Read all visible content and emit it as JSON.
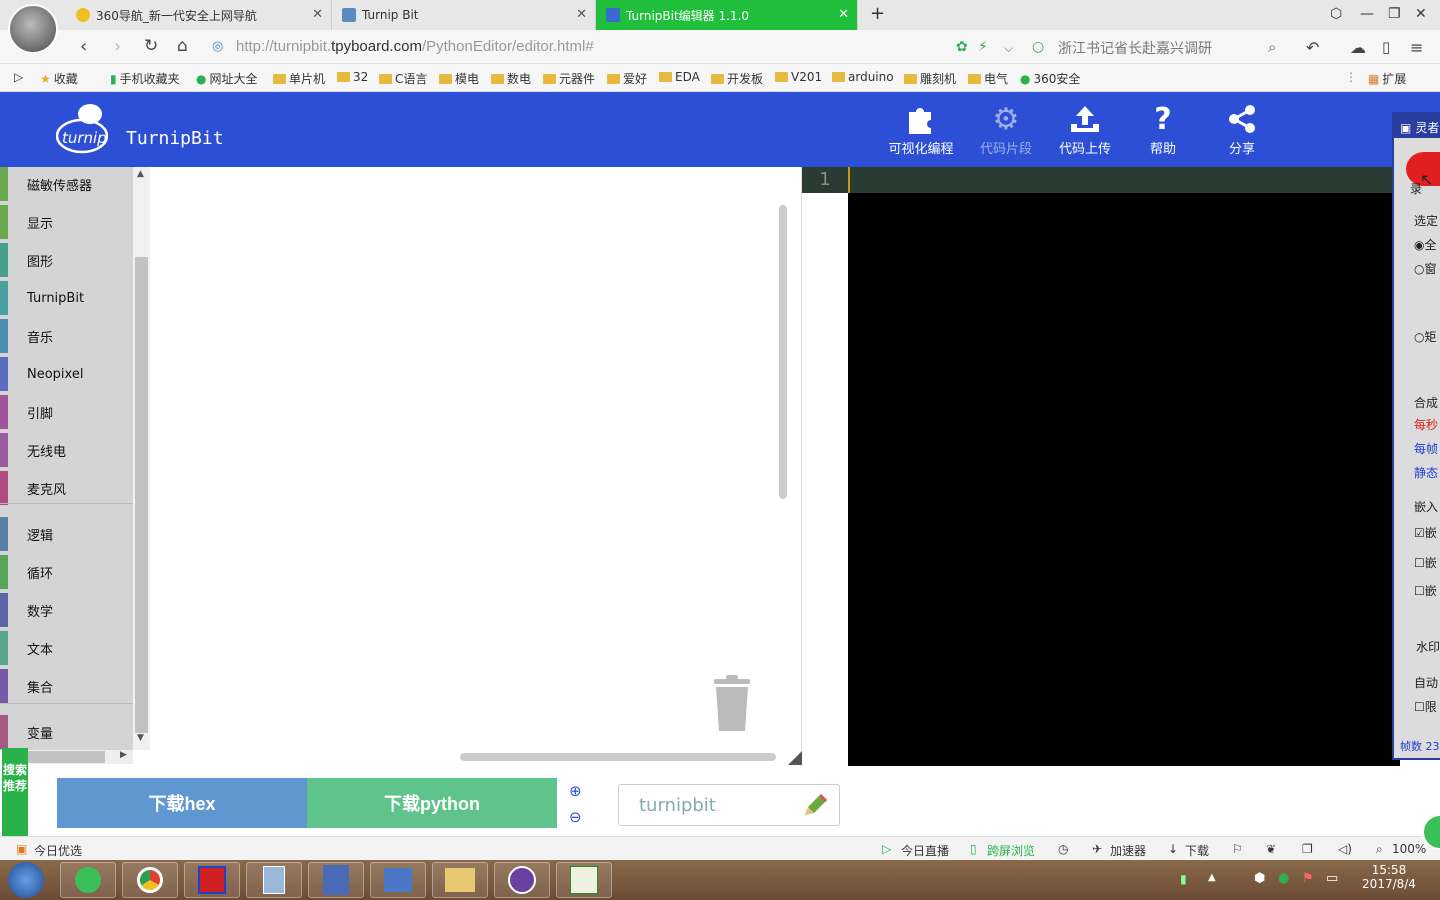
{
  "browser": {
    "tabs": [
      {
        "title": "360导航_新一代安全上网导航"
      },
      {
        "title": "Turnip Bit"
      },
      {
        "title": "TurnipBit编辑器 1.1.0"
      }
    ],
    "url_prefix": "http://turnipbit.",
    "url_domain": "tpyboard.com",
    "url_path": "/PythonEditor/editor.html#",
    "search_hint": "浙江书记省长赴嘉兴调研",
    "bookmarks": [
      "收藏",
      "手机收藏夹",
      "网址大全",
      "单片机",
      "32",
      "C语言",
      "模电",
      "数电",
      "元器件",
      "爱好",
      "EDA",
      "开发板",
      "V201",
      "arduino",
      "雕刻机",
      "电气",
      "360安全"
    ],
    "extensions_label": "扩展"
  },
  "app": {
    "brand": "TurnipBit",
    "logo_text": "turnip",
    "nav": [
      {
        "label": "可视化编程",
        "icon": "puzzle-icon"
      },
      {
        "label": "代码片段",
        "icon": "gears-icon"
      },
      {
        "label": "代码上传",
        "icon": "upload-icon"
      },
      {
        "label": "帮助",
        "icon": "help-icon"
      },
      {
        "label": "分享",
        "icon": "share-icon"
      }
    ],
    "categories": [
      {
        "label": "磁敏传感器",
        "color": "#6aa84f"
      },
      {
        "label": "显示",
        "color": "#6aa84f"
      },
      {
        "label": "图形",
        "color": "#45a08a"
      },
      {
        "label": "TurnipBit",
        "color": "#4aa0a0"
      },
      {
        "label": "音乐",
        "color": "#4a8fb0"
      },
      {
        "label": "Neopixel",
        "color": "#5a6ec0"
      },
      {
        "label": "引脚",
        "color": "#a0559a"
      },
      {
        "label": "无线电",
        "color": "#9a5aa0"
      },
      {
        "label": "麦克风",
        "color": "#b04a80"
      },
      {
        "label": "逻辑",
        "color": "#5b80a5"
      },
      {
        "label": "循环",
        "color": "#5ba55b"
      },
      {
        "label": "数学",
        "color": "#5b67a5"
      },
      {
        "label": "文本",
        "color": "#5ba58c"
      },
      {
        "label": "集合",
        "color": "#745ba5"
      },
      {
        "label": "变量",
        "color": "#a55b80"
      }
    ],
    "line_number": "1",
    "download_hex": "下载hex",
    "download_python": "下载python",
    "filename": "turnipbit",
    "search_recommend": "搜索推荐"
  },
  "side_window": {
    "title": "灵者",
    "record_label": "录",
    "items": [
      "选定",
      "全",
      "窗",
      "矩",
      "合成",
      "每秒",
      "每帧",
      "静态",
      "嵌入",
      "嵌",
      "嵌",
      "嵌",
      "水印",
      "自动",
      "限",
      "帧数 23"
    ]
  },
  "statusbar": {
    "left": "今日优选",
    "live": "今日直播",
    "cross": "跨屏浏览",
    "accelerate": "加速器",
    "download": "下载",
    "zoom": "100%"
  },
  "taskbar": {
    "time": "15:58",
    "date": "2017/8/4"
  }
}
